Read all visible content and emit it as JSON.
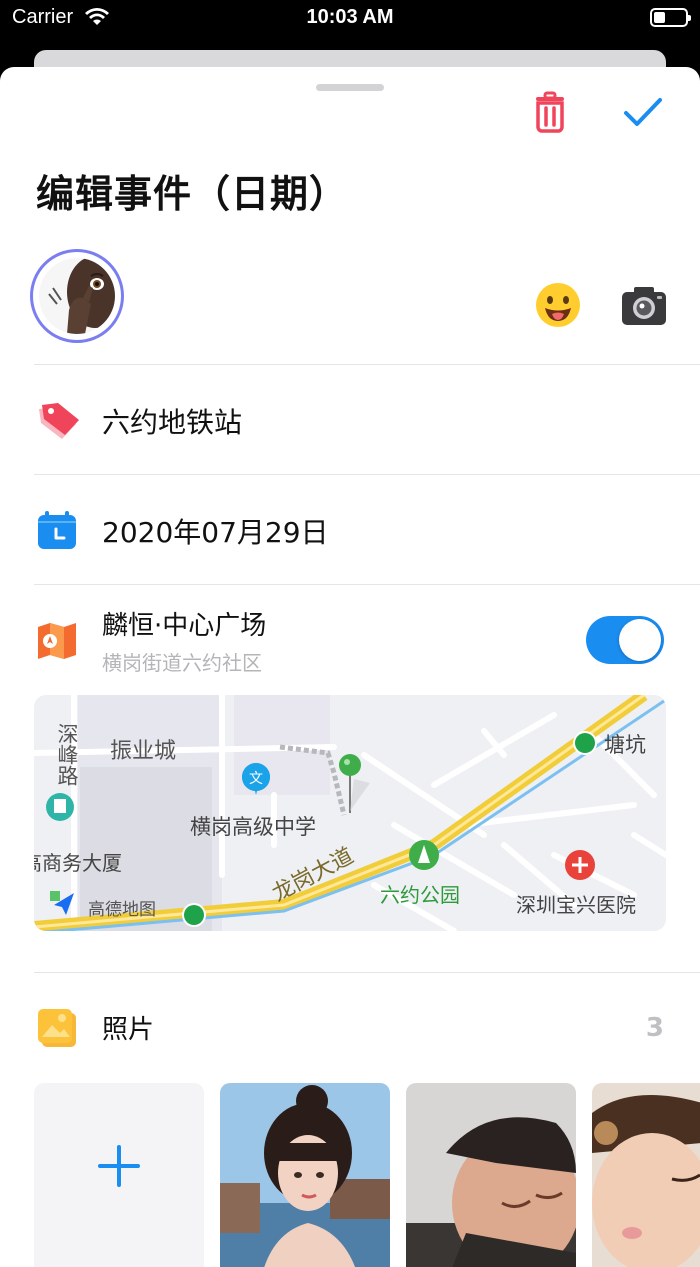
{
  "status": {
    "carrier": "Carrier",
    "time": "10:03 AM"
  },
  "header": {
    "title": "编辑事件（日期）"
  },
  "tag": {
    "label": "六约地铁站"
  },
  "date": {
    "label": "2020年07月29日"
  },
  "location": {
    "name": "麟恒·中心广场",
    "address": "横岗街道六约社区",
    "enabled": true
  },
  "map": {
    "labels": [
      "深",
      "峰",
      "路",
      "振业城",
      "横岗高级中学",
      "龙岗大道",
      "六约公园",
      "深圳宝兴医院",
      "塘坑",
      "高德地图",
      "高商务大厦"
    ]
  },
  "photos": {
    "label": "照片",
    "count": "3"
  },
  "colors": {
    "accent": "#1a8df0",
    "trash": "#f0445a",
    "avatar_ring": "#7a7ef0"
  }
}
